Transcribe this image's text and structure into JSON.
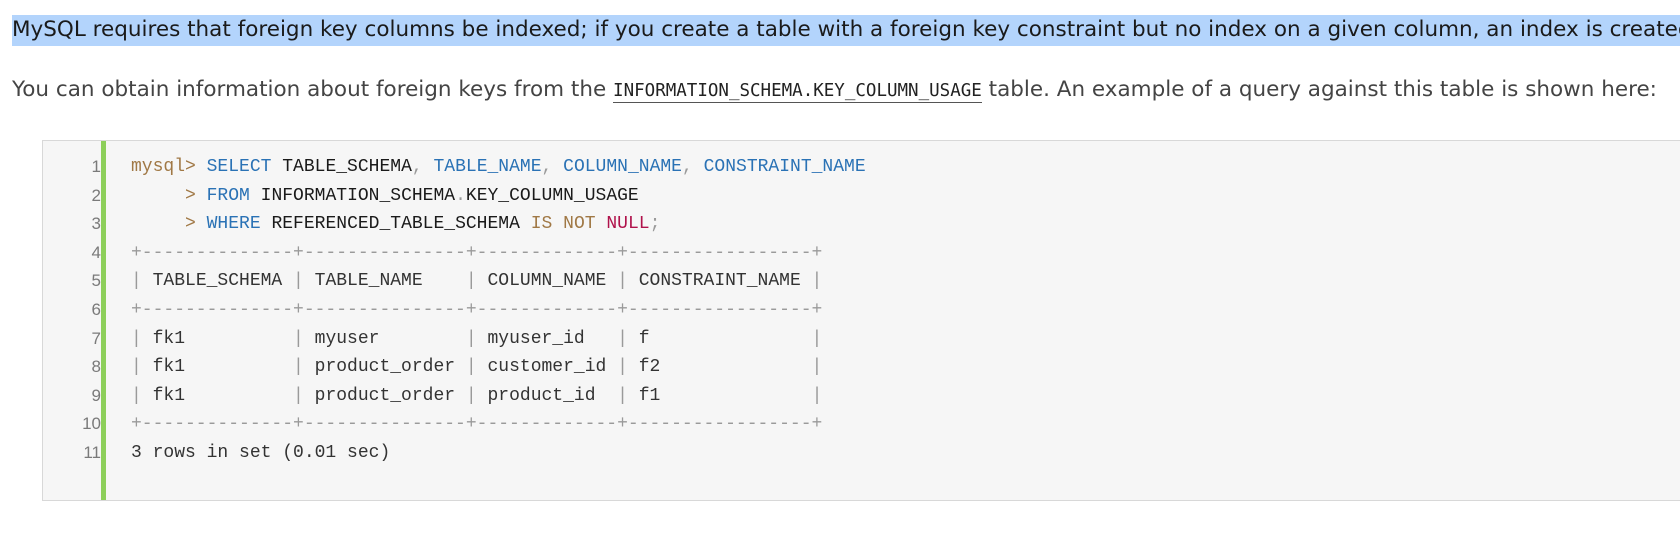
{
  "paragraph1": {
    "text": "MySQL requires that foreign key columns be indexed; if you create a table with a foreign key constraint but no index on a given column, an index is created."
  },
  "paragraph2": {
    "before": "You can obtain information about foreign keys from the ",
    "code": "INFORMATION_SCHEMA.KEY_COLUMN_USAGE",
    "after": " table. An example of a query against this table is shown here:"
  },
  "code_block": {
    "accent_color": "#8dcf5a",
    "line_numbers": [
      "1",
      "2",
      "3",
      "4",
      "5",
      "6",
      "7",
      "8",
      "9",
      "10",
      "11"
    ],
    "query": {
      "prompt": "mysql>",
      "cont_prompt": "     >",
      "select_kw": "SELECT",
      "col1": "TABLE_SCHEMA",
      "col2": "TABLE_NAME",
      "col3": "COLUMN_NAME",
      "col4": "CONSTRAINT_NAME",
      "from_kw": "FROM",
      "from_schema": "INFORMATION_SCHEMA",
      "from_table": "KEY_COLUMN_USAGE",
      "where_kw": "WHERE",
      "where_col": "REFERENCED_TABLE_SCHEMA",
      "is_kw": "IS",
      "not_kw": "NOT",
      "null_kw": "NULL",
      "comma": ",",
      "dot": ".",
      "semicolon": ";"
    },
    "result_border": "+--------------+---------------+-------------+-----------------+",
    "result_headers": [
      "TABLE_SCHEMA",
      "TABLE_NAME",
      "COLUMN_NAME",
      "CONSTRAINT_NAME"
    ],
    "result_rows": [
      [
        "fk1",
        "myuser",
        "myuser_id",
        "f"
      ],
      [
        "fk1",
        "product_order",
        "customer_id",
        "f2"
      ],
      [
        "fk1",
        "product_order",
        "product_id",
        "f1"
      ]
    ],
    "footer": "3 rows in set (0.01 sec)"
  }
}
